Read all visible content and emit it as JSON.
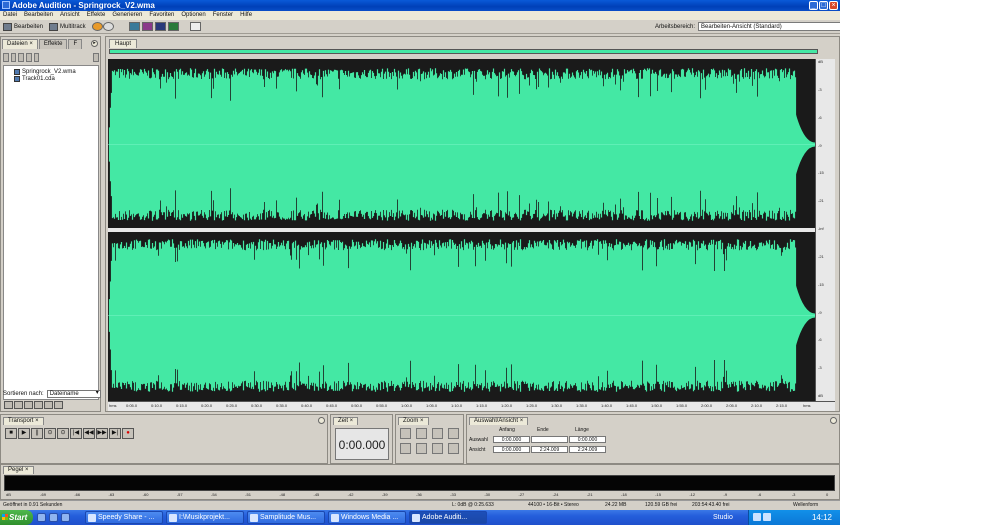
{
  "window": {
    "title": "Adobe Audition - Springrock_V2.wma",
    "buttons": [
      "_",
      "□",
      "×"
    ]
  },
  "menu": [
    "Datei",
    "Bearbeiten",
    "Ansicht",
    "Effekte",
    "Generieren",
    "Favoriten",
    "Optionen",
    "Fenster",
    "Hilfe"
  ],
  "toolbar": {
    "edit_label": "Bearbeiten",
    "multitrack_label": "Multitrack",
    "workspace_label": "Arbeitsbereich:",
    "workspace_value": "Bearbeiten-Ansicht (Standard)"
  },
  "files_panel": {
    "tabs": [
      "Dateien",
      "Effekte",
      "F"
    ],
    "files": [
      "Springrock_V2.wma",
      "Track01.cda"
    ],
    "sort_label": "Sortieren nach:",
    "sort_value": "Dateiname"
  },
  "main": {
    "tab_label": "Haupt",
    "waveform_color": "#44e8a4",
    "db_labels": [
      "dB",
      "-3",
      "-6",
      "-9",
      "-15",
      "-21",
      "-inf",
      "-21",
      "-15",
      "-9",
      "-6",
      "-3",
      "dB"
    ],
    "timeline_start": "hms",
    "timeline_end": "hms",
    "timeline_ticks": [
      "0:05.0",
      "0:10.0",
      "0:15.0",
      "0:20.0",
      "0:25.0",
      "0:30.0",
      "0:35.0",
      "0:40.0",
      "0:45.0",
      "0:50.0",
      "0:55.0",
      "1:00.0",
      "1:05.0",
      "1:10.0",
      "1:15.0",
      "1:20.0",
      "1:25.0",
      "1:30.0",
      "1:35.0",
      "1:40.0",
      "1:45.0",
      "1:50.0",
      "1:55.0",
      "2:00.0",
      "2:05.0",
      "2:10.0",
      "2:15.0"
    ]
  },
  "transport": {
    "title": "Transport",
    "buttons": [
      "■",
      "▶",
      "||",
      "⊙",
      "⊙",
      "|◀",
      "◀◀",
      "▶▶",
      "▶|",
      "●"
    ]
  },
  "time_panel": {
    "title": "Zeit",
    "value": "0:00.000"
  },
  "zoom_panel": {
    "title": "Zoom"
  },
  "selection_panel": {
    "title": "Auswahl/Ansicht",
    "headers": [
      "Anfang",
      "Ende",
      "Länge"
    ],
    "rows": [
      {
        "label": "Auswahl",
        "values": [
          "0:00.000",
          "",
          "0:00.000"
        ]
      },
      {
        "label": "Ansicht",
        "values": [
          "0:00.000",
          "2:24.009",
          "2:24.009"
        ]
      }
    ]
  },
  "pegel": {
    "title": "Pegel",
    "scale": [
      "dB",
      "-69",
      "-66",
      "-63",
      "-60",
      "-57",
      "-54",
      "-51",
      "-48",
      "-45",
      "-42",
      "-39",
      "-36",
      "-33",
      "-30",
      "-27",
      "-24",
      "-21",
      "-18",
      "-15",
      "-12",
      "-9",
      "-6",
      "-3",
      "0"
    ]
  },
  "status": {
    "left": "Geöffnet in 0.91 Sekunden",
    "level": "L: 0dB @ 0:25.633",
    "format": "44100 • 16-Bit • Stereo",
    "size": "24.22 MB",
    "free": "120.59 GB frei",
    "free_time": "203:54:43.40 frei",
    "view": "Wellenform"
  },
  "taskbar": {
    "start": "Start",
    "items": [
      "Speedy Share - ...",
      "I:\\Musikprojekt...",
      "Samplitude Mus...",
      "Windows Media ...",
      "Adobe Auditi..."
    ],
    "language": "Studio",
    "time": "14:12"
  }
}
